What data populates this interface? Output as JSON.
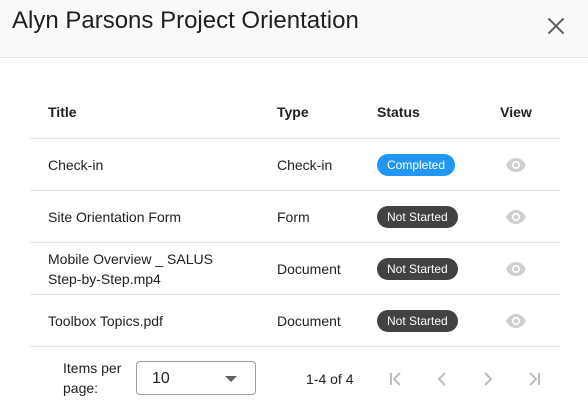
{
  "dialog": {
    "title": "Alyn Parsons Project Orientation"
  },
  "table": {
    "columns": {
      "title": "Title",
      "type": "Type",
      "status": "Status",
      "view": "View"
    },
    "rows": [
      {
        "title_line1": "Check-in",
        "title_line2": "",
        "type": "Check-in",
        "status": "Completed",
        "status_color": "#2196f3"
      },
      {
        "title_line1": "Site Orientation Form",
        "title_line2": "",
        "type": "Form",
        "status": "Not Started",
        "status_color": "#424242"
      },
      {
        "title_line1": "Mobile Overview _ SALUS",
        "title_line2": "Step-by-Step.mp4",
        "type": "Document",
        "status": "Not Started",
        "status_color": "#424242"
      },
      {
        "title_line1": "Toolbox Topics.pdf",
        "title_line2": "",
        "type": "Document",
        "status": "Not Started",
        "status_color": "#424242"
      }
    ]
  },
  "pagination": {
    "items_per_page_label_line1": "Items per",
    "items_per_page_label_line2": "page:",
    "items_per_page_value": "10",
    "range_text": "1-4 of 4"
  },
  "icons": {
    "close": "close-icon",
    "view": "eye-icon",
    "first_page": "first-page-icon",
    "prev_page": "chevron-left-icon",
    "next_page": "chevron-right-icon",
    "last_page": "last-page-icon",
    "dropdown": "caret-down-icon"
  },
  "colors": {
    "completed": "#2196f3",
    "not_started": "#424242",
    "icon_disabled": "#bdbdbd"
  }
}
